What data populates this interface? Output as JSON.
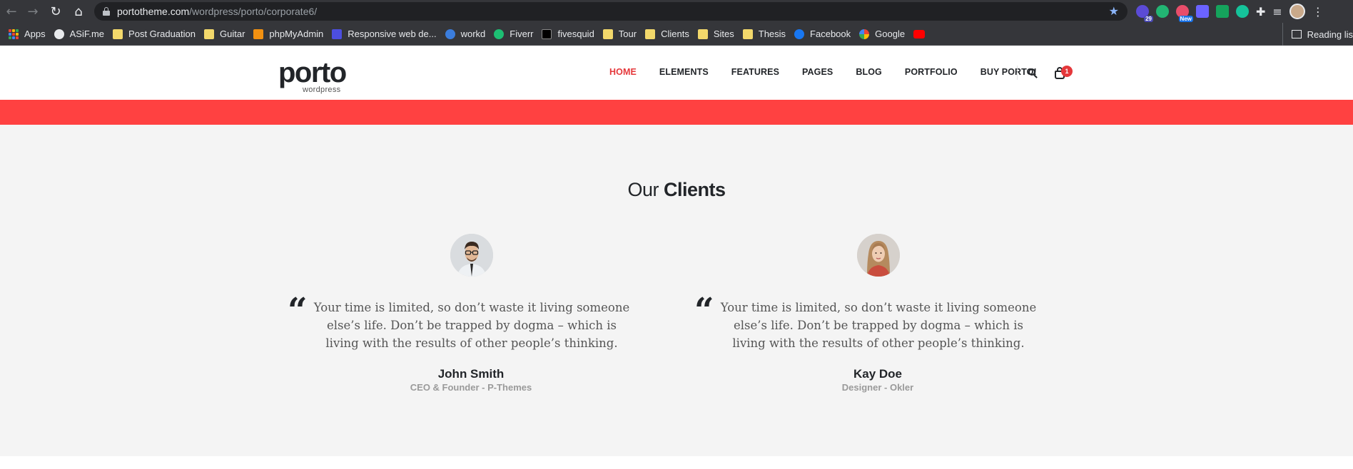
{
  "browser": {
    "url_domain": "portotheme.com",
    "url_path": "/wordpress/porto/corporate6/",
    "extensions": [
      {
        "name": "extension-1-icon",
        "color": "#5b4bd6",
        "badge": "29"
      },
      {
        "name": "extension-2-icon",
        "color": "#22b573",
        "badge": ""
      },
      {
        "name": "extension-3-icon",
        "color": "#e84d6a",
        "badge": "New"
      },
      {
        "name": "extension-4-icon",
        "color": "#6b63ff",
        "badge": ""
      },
      {
        "name": "extension-5-icon",
        "color": "#15a35c",
        "badge": ""
      },
      {
        "name": "grammarly-icon",
        "color": "#15c39a",
        "badge": ""
      }
    ],
    "bookmarks": [
      {
        "label": "Apps",
        "icon": "apps-grid-icon"
      },
      {
        "label": "ASiF.me",
        "icon": "globe-icon"
      },
      {
        "label": "Post Graduation",
        "icon": "folder-icon"
      },
      {
        "label": "Guitar",
        "icon": "folder-icon"
      },
      {
        "label": "phpMyAdmin",
        "icon": "phpmyadmin-icon"
      },
      {
        "label": "Responsive web de...",
        "icon": "w-icon"
      },
      {
        "label": "workd",
        "icon": "workd-icon"
      },
      {
        "label": "Fiverr",
        "icon": "fiverr-icon"
      },
      {
        "label": "fivesquid",
        "icon": "fivesquid-icon"
      },
      {
        "label": "Tour",
        "icon": "folder-icon"
      },
      {
        "label": "Clients",
        "icon": "folder-icon"
      },
      {
        "label": "Sites",
        "icon": "folder-icon"
      },
      {
        "label": "Thesis",
        "icon": "folder-icon"
      },
      {
        "label": "Facebook",
        "icon": "facebook-icon"
      },
      {
        "label": "Google",
        "icon": "google-icon"
      },
      {
        "label": "",
        "icon": "youtube-icon"
      }
    ],
    "reading_list": "Reading lis"
  },
  "site": {
    "logo": "porto",
    "logo_sub": "wordpress",
    "nav": [
      "HOME",
      "ELEMENTS",
      "FEATURES",
      "PAGES",
      "BLOG",
      "PORTFOLIO",
      "BUY PORTO!"
    ],
    "cart_count": "1",
    "accent": "#e5383b"
  },
  "clients": {
    "title_light": "Our",
    "title_bold": "Clients",
    "testimonials": [
      {
        "quote": "Your time is limited, so don’t waste it living someone else’s life. Don’t be trapped by dogma – which is living with the results of other people’s thinking.",
        "name": "John Smith",
        "role": "CEO & Founder - P-Themes"
      },
      {
        "quote": "Your time is limited, so don’t waste it living someone else’s life. Don’t be trapped by dogma – which is living with the results of other people’s thinking.",
        "name": "Kay Doe",
        "role": "Designer - Okler"
      }
    ]
  }
}
